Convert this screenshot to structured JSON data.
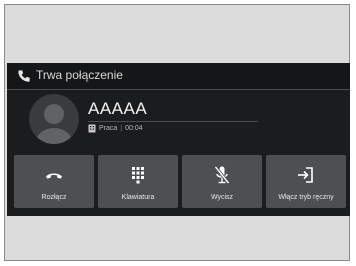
{
  "header": {
    "title": "Trwa połączenie",
    "icon": "phone-icon"
  },
  "contact": {
    "name": "AAAAA",
    "type": "Praca",
    "separator": "|",
    "duration": "00:04"
  },
  "buttons": [
    {
      "label": "Rozłącz",
      "icon": "hang-up-icon"
    },
    {
      "label": "Klawiatura",
      "icon": "keypad-icon"
    },
    {
      "label": "Wycisz",
      "icon": "mute-mic-icon"
    },
    {
      "label": "Włącz tryb ręczny",
      "icon": "handset-mode-icon"
    }
  ]
}
